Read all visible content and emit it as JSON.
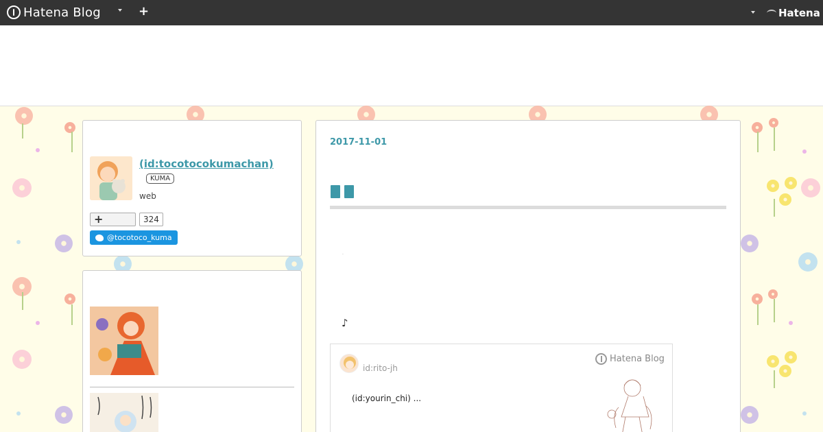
{
  "global_header": {
    "logo_text": "Hatena Blog",
    "add_icon": "plus-icon",
    "brand_text": "Hatena"
  },
  "profile": {
    "name": " (id:tocotocokumachan)",
    "badge": "KUMA",
    "description": "web",
    "follow_count": "324",
    "twitter_handle": "@tocotoco_kuma"
  },
  "entry": {
    "date": "2017-11-01",
    "body_mark": "·",
    "music_note": "♪",
    "embed": {
      "user": "id:rito-jh",
      "logo_text": "Hatena Blog",
      "excerpt": "(id:yourin_chi) ..."
    }
  },
  "colors": {
    "accent": "#3d98a8",
    "header_bg": "#343434",
    "page_bg": "#fffde8",
    "twitter": "#1b95e0"
  }
}
